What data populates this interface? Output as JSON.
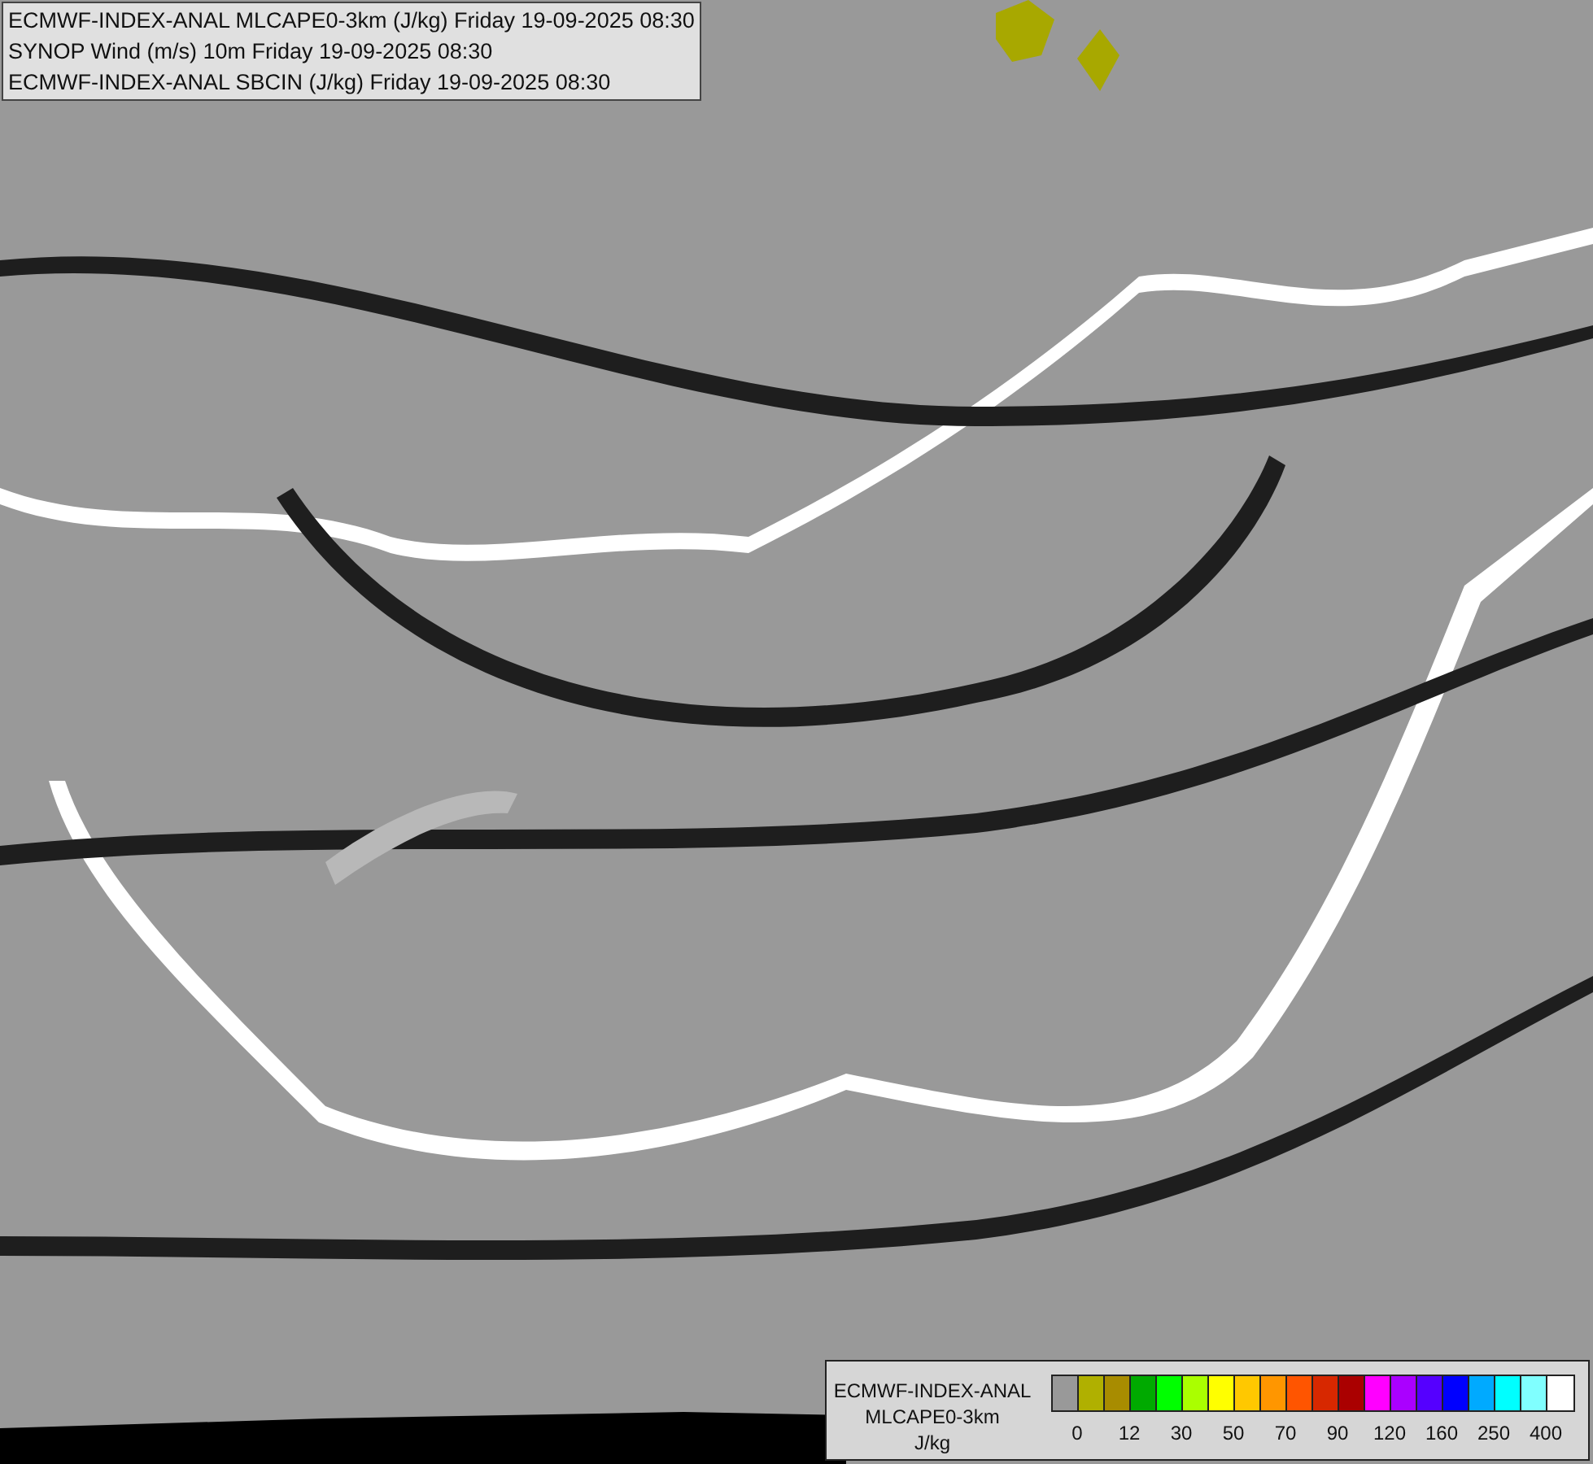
{
  "header": {
    "lines": [
      "ECMWF-INDEX-ANAL MLCAPE0-3km (J/kg) Friday 19-09-2025 08:30",
      "SYNOP Wind (m/s) 10m Friday 19-09-2025 08:30",
      "ECMWF-INDEX-ANAL SBCIN (J/kg) Friday 19-09-2025 08:30"
    ]
  },
  "legend": {
    "title_lines": [
      "ECMWF-INDEX-ANAL",
      "MLCAPE0-3km",
      "J/kg"
    ],
    "swatches": [
      {
        "color": "#999999"
      },
      {
        "color": "#b0b000"
      },
      {
        "color": "#a88c00"
      },
      {
        "color": "#00aa00"
      },
      {
        "color": "#00ff00"
      },
      {
        "color": "#aaff00"
      },
      {
        "color": "#ffff00"
      },
      {
        "color": "#ffc800"
      },
      {
        "color": "#ff9600"
      },
      {
        "color": "#ff5500"
      },
      {
        "color": "#d72800"
      },
      {
        "color": "#aa0000"
      },
      {
        "color": "#ff00ff"
      },
      {
        "color": "#aa00ff"
      },
      {
        "color": "#5500ff"
      },
      {
        "color": "#0000ff"
      },
      {
        "color": "#00aaff"
      },
      {
        "color": "#00ffff"
      },
      {
        "color": "#80ffff"
      },
      {
        "color": "#ffffff"
      }
    ],
    "ticks": [
      "0",
      "12",
      "30",
      "50",
      "70",
      "90",
      "120",
      "160",
      "250",
      "400"
    ]
  }
}
